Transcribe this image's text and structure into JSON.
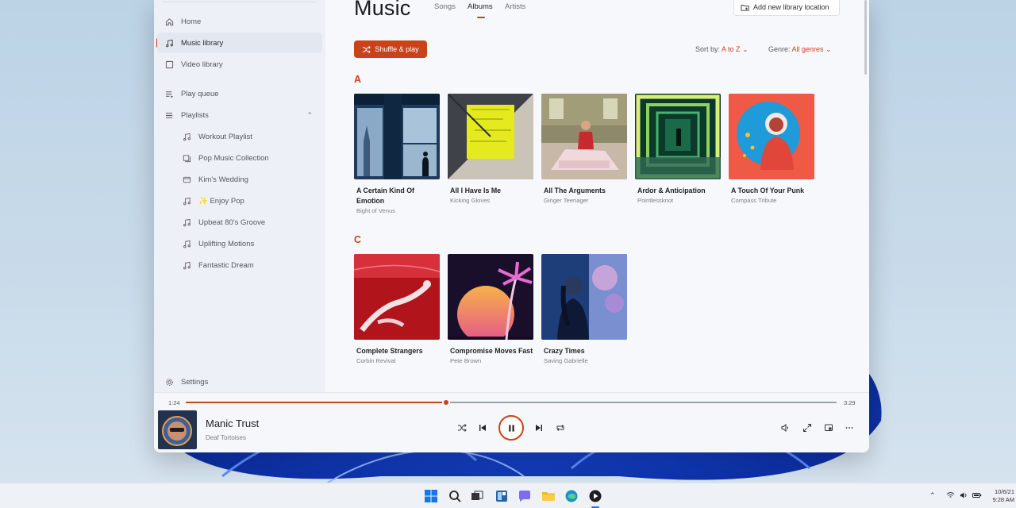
{
  "colors": {
    "accent": "#c8431a",
    "sidebar": "#edf0f6",
    "content": "#f7f8fb"
  },
  "sidebar": {
    "items": [
      {
        "label": "Home",
        "icon": "home-icon"
      },
      {
        "label": "Music library",
        "icon": "music-note-icon",
        "active": true
      },
      {
        "label": "Video library",
        "icon": "video-icon"
      },
      {
        "label": "Play queue",
        "icon": "queue-icon"
      },
      {
        "label": "Playlists",
        "icon": "playlist-icon"
      }
    ],
    "playlists": [
      {
        "label": "Workout Playlist",
        "icon": "music-note-icon"
      },
      {
        "label": "Pop Music Collection",
        "icon": "collection-icon"
      },
      {
        "label": "Kim's Wedding",
        "icon": "video-icon"
      },
      {
        "label": "✨ Enjoy Pop",
        "icon": "music-note-icon"
      },
      {
        "label": "Upbeat 80's Groove",
        "icon": "music-note-icon"
      },
      {
        "label": "Uplifting Motions",
        "icon": "music-note-icon"
      },
      {
        "label": "Fantastic Dream",
        "icon": "music-note-icon"
      }
    ],
    "settings": "Settings"
  },
  "header": {
    "title": "Music",
    "tabs": [
      "Songs",
      "Albums",
      "Artists"
    ],
    "active_tab": "Albums",
    "add_location": "Add new library location"
  },
  "toolbar": {
    "shuffle": "Shuffle & play",
    "sort_label": "Sort by:",
    "sort_value": "A to Z",
    "genre_label": "Genre:",
    "genre_value": "All genres"
  },
  "sections": [
    {
      "letter": "A",
      "albums": [
        {
          "title": "A Certain Kind Of Emotion",
          "artist": "Bight of Venus"
        },
        {
          "title": "All I Have Is Me",
          "artist": "Kicking Gloves"
        },
        {
          "title": "All The Arguments",
          "artist": "Ginger Teenager"
        },
        {
          "title": "Ardor & Anticipation",
          "artist": "Pointlessknot"
        },
        {
          "title": "A Touch Of Your Punk",
          "artist": "Compass Tribute"
        }
      ]
    },
    {
      "letter": "C",
      "albums": [
        {
          "title": "Complete Strangers",
          "artist": "Corbin Revival"
        },
        {
          "title": "Compromise Moves Fast",
          "artist": "Pete Brown"
        },
        {
          "title": "Crazy Times",
          "artist": "Saving Gabrielle"
        }
      ]
    }
  ],
  "player": {
    "elapsed": "1:24",
    "duration": "3:29",
    "progress": 0.4,
    "title": "Manic Trust",
    "artist": "Deaf Tortoises"
  },
  "taskbar": {
    "time": "9:28 AM",
    "date": "10/6/21"
  }
}
